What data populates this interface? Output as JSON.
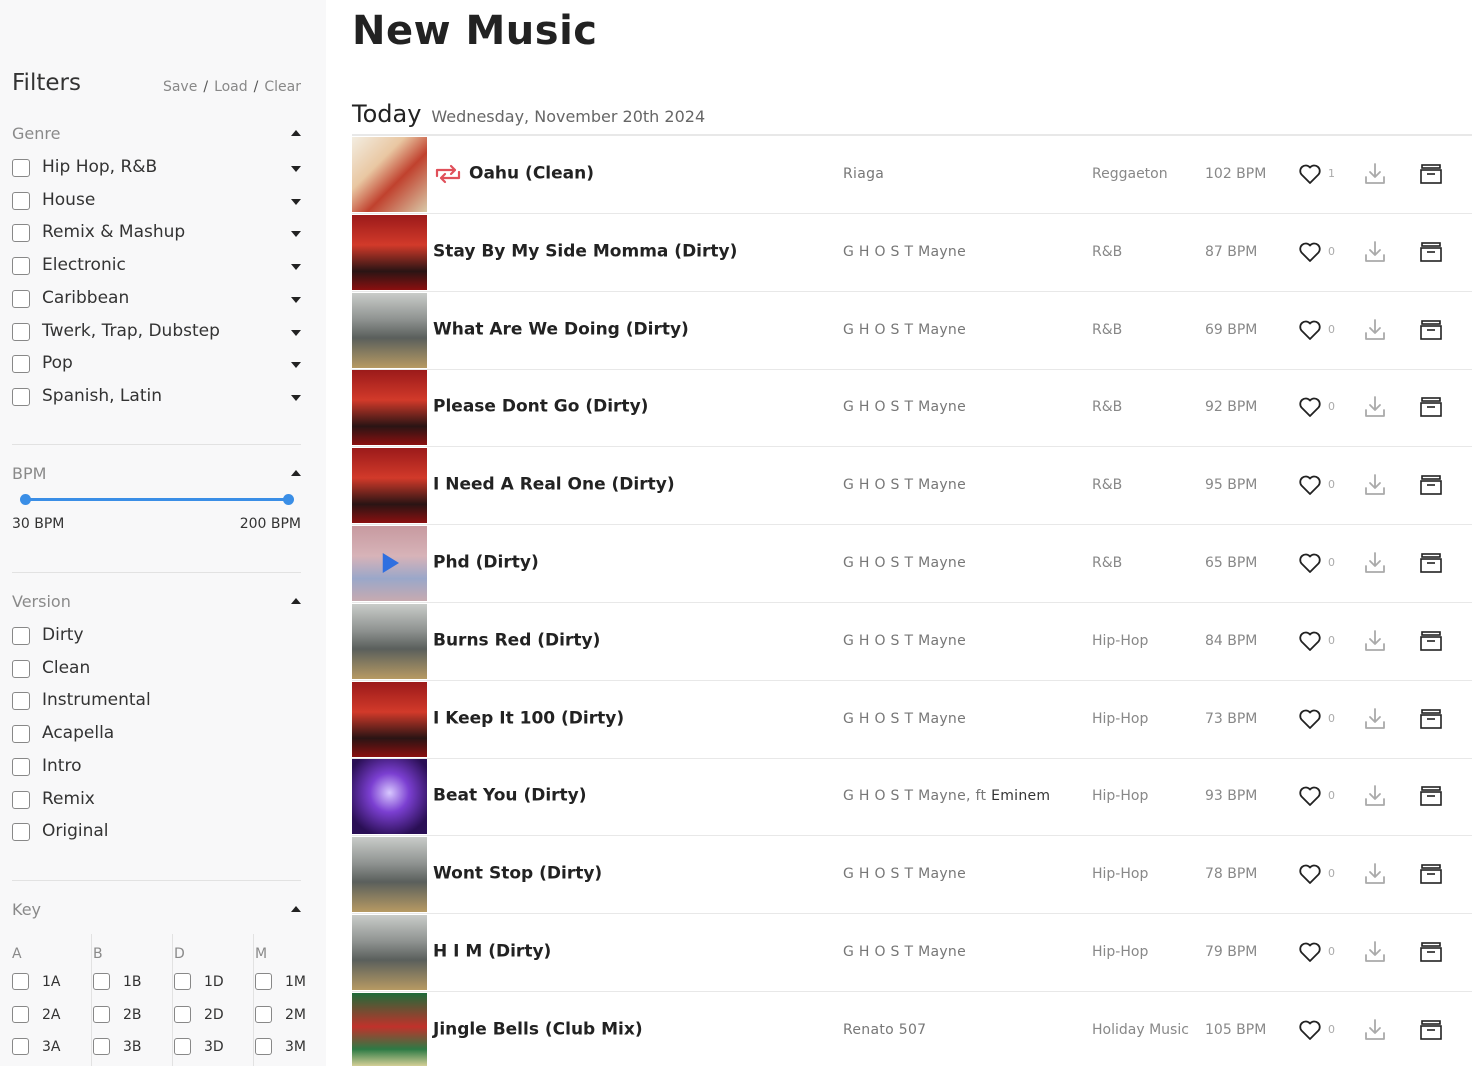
{
  "sidebar": {
    "title": "Filters",
    "actions": {
      "save": "Save",
      "load": "Load",
      "clear": "Clear"
    },
    "genre": {
      "title": "Genre",
      "items": [
        "Hip Hop, R&B",
        "House",
        "Remix & Mashup",
        "Electronic",
        "Caribbean",
        "Twerk, Trap, Dubstep",
        "Pop",
        "Spanish, Latin"
      ]
    },
    "bpm": {
      "title": "BPM",
      "min_label": "30 BPM",
      "max_label": "200 BPM"
    },
    "version": {
      "title": "Version",
      "items": [
        "Dirty",
        "Clean",
        "Instrumental",
        "Acapella",
        "Intro",
        "Remix",
        "Original"
      ]
    },
    "key": {
      "title": "Key",
      "columns": [
        {
          "letter": "A",
          "items": [
            "1A",
            "2A",
            "3A"
          ]
        },
        {
          "letter": "B",
          "items": [
            "1B",
            "2B",
            "3B"
          ]
        },
        {
          "letter": "D",
          "items": [
            "1D",
            "2D",
            "3D"
          ]
        },
        {
          "letter": "M",
          "items": [
            "1M",
            "2M",
            "3M"
          ]
        }
      ]
    }
  },
  "main": {
    "title": "New Music",
    "day_label": "Today",
    "day_date": "Wednesday, November 20th 2024",
    "tracks": [
      {
        "title": "Oahu (Clean)",
        "artist": "Riaga",
        "feat": "",
        "genre": "Reggaeton",
        "bpm": "102 BPM",
        "likes": "1",
        "repost": true
      },
      {
        "title": "Stay By My Side Momma (Dirty)",
        "artist": "G H O S T Mayne",
        "feat": "",
        "genre": "R&B",
        "bpm": "87 BPM",
        "likes": "0",
        "repost": false
      },
      {
        "title": "What Are We Doing (Dirty)",
        "artist": "G H O S T Mayne",
        "feat": "",
        "genre": "R&B",
        "bpm": "69 BPM",
        "likes": "0",
        "repost": false
      },
      {
        "title": "Please Dont Go (Dirty)",
        "artist": "G H O S T Mayne",
        "feat": "",
        "genre": "R&B",
        "bpm": "92 BPM",
        "likes": "0",
        "repost": false
      },
      {
        "title": "I Need A Real One (Dirty)",
        "artist": "G H O S T Mayne",
        "feat": "",
        "genre": "R&B",
        "bpm": "95 BPM",
        "likes": "0",
        "repost": false
      },
      {
        "title": "Phd (Dirty)",
        "artist": "G H O S T Mayne",
        "feat": "",
        "genre": "R&B",
        "bpm": "65 BPM",
        "likes": "0",
        "repost": false
      },
      {
        "title": "Burns Red (Dirty)",
        "artist": "G H O S T Mayne",
        "feat": "",
        "genre": "Hip-Hop",
        "bpm": "84 BPM",
        "likes": "0",
        "repost": false
      },
      {
        "title": "I Keep It 100 (Dirty)",
        "artist": "G H O S T Mayne",
        "feat": "",
        "genre": "Hip-Hop",
        "bpm": "73 BPM",
        "likes": "0",
        "repost": false
      },
      {
        "title": "Beat You (Dirty)",
        "artist": "G H O S T Mayne, ft",
        "feat": "Eminem",
        "genre": "Hip-Hop",
        "bpm": "93 BPM",
        "likes": "0",
        "repost": false
      },
      {
        "title": "Wont Stop (Dirty)",
        "artist": "G H O S T Mayne",
        "feat": "",
        "genre": "Hip-Hop",
        "bpm": "78 BPM",
        "likes": "0",
        "repost": false
      },
      {
        "title": "H I M (Dirty)",
        "artist": "G H O S T Mayne",
        "feat": "",
        "genre": "Hip-Hop",
        "bpm": "79 BPM",
        "likes": "0",
        "repost": false
      },
      {
        "title": "Jingle Bells (Club Mix)",
        "artist": "Renato 507",
        "feat": "",
        "genre": "Holiday Music",
        "bpm": "105 BPM",
        "likes": "0",
        "repost": false
      }
    ]
  },
  "colors": {
    "accent": "#3a8ee6",
    "repost": "#e0505a"
  }
}
